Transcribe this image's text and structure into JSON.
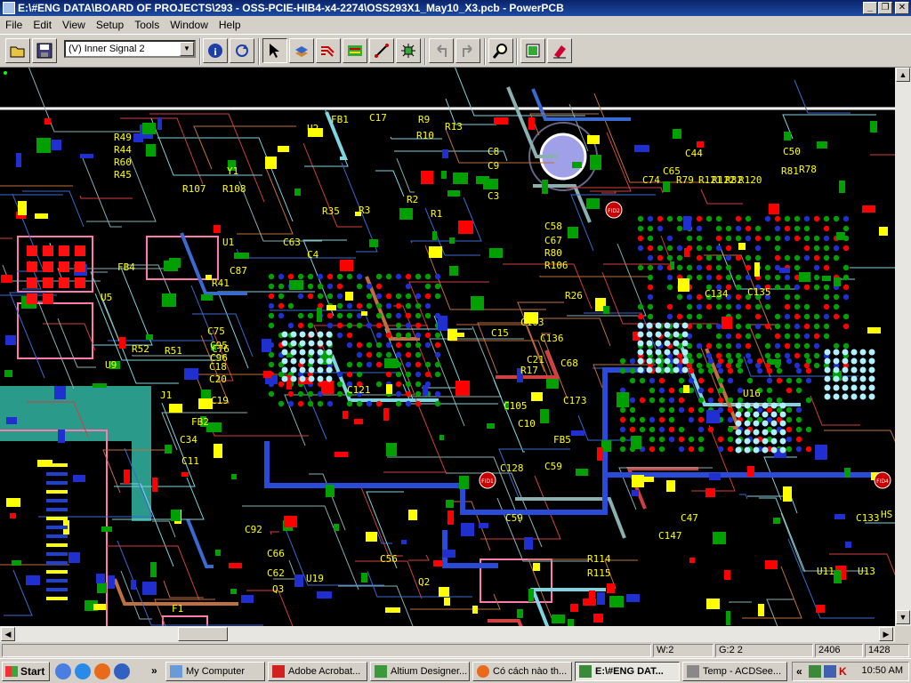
{
  "window": {
    "title": "E:\\#ENG DATA\\BOARD OF PROJECTS\\293 - OSS-PCIE-HIB4-x4-2274\\OSS293X1_May10_X3.pcb - PowerPCB",
    "minimize": "_",
    "maximize": "❐",
    "close": "✕"
  },
  "menu": [
    "File",
    "Edit",
    "View",
    "Setup",
    "Tools",
    "Window",
    "Help"
  ],
  "toolbar": {
    "layer_select": "(V) Inner Signal 2",
    "icons": [
      "open-icon",
      "save-icon",
      "info-icon",
      "refresh-icon",
      "select-arrow-icon",
      "layer-icon",
      "route-icon",
      "design-rules-icon",
      "line-icon",
      "component-icon",
      "undo-icon",
      "redo-icon",
      "zoom-icon",
      "layers-icon",
      "eraser-icon"
    ]
  },
  "pcb": {
    "refdes": [
      {
        "t": "U2"
      },
      {
        "t": "FB1"
      },
      {
        "t": "C17"
      },
      {
        "t": "R9"
      },
      {
        "t": "R10"
      },
      {
        "t": "R13"
      },
      {
        "t": "C8"
      },
      {
        "t": "C9"
      },
      {
        "t": "C3"
      },
      {
        "t": "R3"
      },
      {
        "t": "R2"
      },
      {
        "t": "R1"
      },
      {
        "t": "R49"
      },
      {
        "t": "R44"
      },
      {
        "t": "R60"
      },
      {
        "t": "R45"
      },
      {
        "t": "Y1"
      },
      {
        "t": "U1"
      },
      {
        "t": "FB4"
      },
      {
        "t": "U5"
      },
      {
        "t": "R41"
      },
      {
        "t": "C87"
      },
      {
        "t": "C4"
      },
      {
        "t": "C63"
      },
      {
        "t": "C58"
      },
      {
        "t": "C67"
      },
      {
        "t": "R80"
      },
      {
        "t": "R106"
      },
      {
        "t": "R26"
      },
      {
        "t": "C74"
      },
      {
        "t": "C65"
      },
      {
        "t": "C44"
      },
      {
        "t": "R79"
      },
      {
        "t": "R121"
      },
      {
        "t": "R122"
      },
      {
        "t": "R82"
      },
      {
        "t": "R120"
      },
      {
        "t": "U9"
      },
      {
        "t": "C103"
      },
      {
        "t": "C15"
      },
      {
        "t": "C136"
      },
      {
        "t": "C21"
      },
      {
        "t": "R17"
      },
      {
        "t": "C68"
      },
      {
        "t": "J1"
      },
      {
        "t": "C19"
      },
      {
        "t": "C20"
      },
      {
        "t": "C18"
      },
      {
        "t": "FB2"
      },
      {
        "t": "C34"
      },
      {
        "t": "C11"
      },
      {
        "t": "C105"
      },
      {
        "t": "C10"
      },
      {
        "t": "FB5"
      },
      {
        "t": "C59"
      },
      {
        "t": "C173"
      },
      {
        "t": "C128"
      },
      {
        "t": "U16"
      },
      {
        "t": "C66"
      },
      {
        "t": "C62"
      },
      {
        "t": "Q3"
      },
      {
        "t": "U19"
      },
      {
        "t": "C56"
      },
      {
        "t": "Q2"
      },
      {
        "t": "R114"
      },
      {
        "t": "R115"
      },
      {
        "t": "U11"
      },
      {
        "t": "U13"
      },
      {
        "t": "F1"
      },
      {
        "t": "C147"
      },
      {
        "t": "C47"
      },
      {
        "t": "C133"
      },
      {
        "t": "HS"
      },
      {
        "t": "C75"
      },
      {
        "t": "C76"
      },
      {
        "t": "C92"
      },
      {
        "t": "R52"
      },
      {
        "t": "R51"
      },
      {
        "t": "C59"
      },
      {
        "t": "R108"
      },
      {
        "t": "R107"
      },
      {
        "t": "R78"
      },
      {
        "t": "R81"
      },
      {
        "t": "C50"
      },
      {
        "t": "C134"
      },
      {
        "t": "C135"
      },
      {
        "t": "R35"
      },
      {
        "t": "C95"
      },
      {
        "t": "C96"
      },
      {
        "t": "C121"
      }
    ],
    "fiducial_labels": [
      "FID2",
      "FID1",
      "FID4"
    ]
  },
  "status": {
    "w": "W:2",
    "g": "G:2 2",
    "x": "2406",
    "y": "1428"
  },
  "taskbar": {
    "start": "Start",
    "more": "»",
    "tasks": [
      "My Computer",
      "Adobe Acrobat...",
      "Altium Designer...",
      "Có cách nào th...",
      "E:\\#ENG DAT...",
      "Temp - ACDSee..."
    ],
    "clock": "10:50 AM",
    "tray_more": "«"
  }
}
